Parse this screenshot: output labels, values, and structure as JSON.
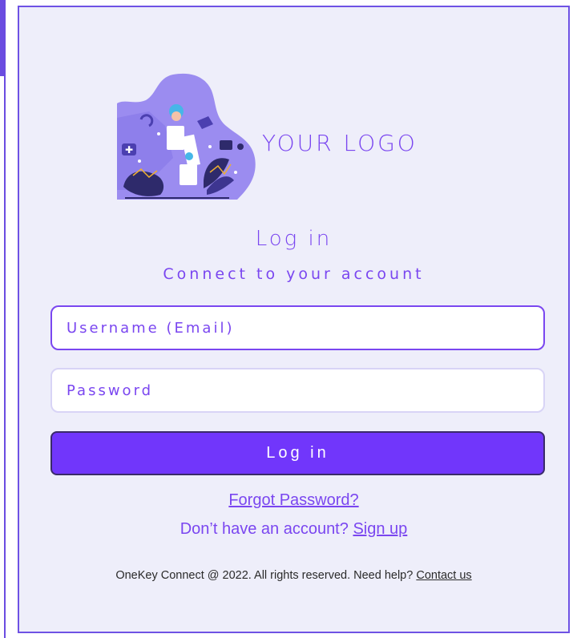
{
  "colors": {
    "accent": "#7a46f0",
    "button": "#7136fb",
    "panel_bg": "#eeeefa",
    "border": "#6e52e4"
  },
  "logo": {
    "text": "YOUR LOGO",
    "icon": "medical-illustration"
  },
  "form": {
    "title": "Log in",
    "subtitle": "Connect to your account",
    "username_placeholder": "Username (Email)",
    "password_placeholder": "Password",
    "submit_label": "Log in"
  },
  "links": {
    "forgot": "Forgot Password?",
    "no_account": "Don’t have an account?",
    "signup": "Sign up"
  },
  "footer": {
    "text": "OneKey Connect @ 2022. All rights reserved. Need help?",
    "contact": "Contact us"
  }
}
